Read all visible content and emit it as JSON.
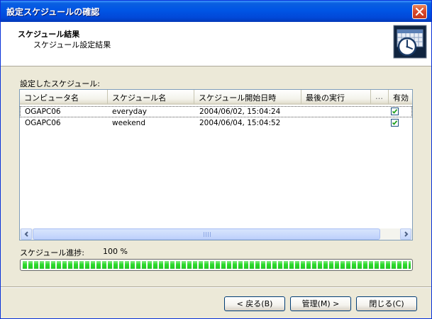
{
  "window": {
    "title": "設定スケジュールの確認"
  },
  "header": {
    "title": "スケジュール結果",
    "subtitle": "スケジュール設定結果"
  },
  "list": {
    "label": "設定したスケジュール:",
    "columns": [
      "コンピュータ名",
      "スケジュール名",
      "スケジュール開始日時",
      "最後の実行",
      "…",
      "有効"
    ],
    "rows": [
      {
        "computer": "OGAPC06",
        "schedule": "everyday",
        "start": "2004/06/02, 15:04:24",
        "last_run": "",
        "enabled": true
      },
      {
        "computer": "OGAPC06",
        "schedule": "weekend",
        "start": "2004/06/04, 15:04:52",
        "last_run": "",
        "enabled": true
      }
    ]
  },
  "progress": {
    "label": "スケジュール進捗:",
    "value_text": "100 %",
    "percent": 100
  },
  "buttons": {
    "back": "< 戻る(B)",
    "manage": "管理(M) >",
    "close": "閉じる(C)"
  },
  "colors": {
    "title_bar": "#0055E5",
    "progress": "#2ADA2A",
    "dialog_bg": "#ECE9D8"
  }
}
